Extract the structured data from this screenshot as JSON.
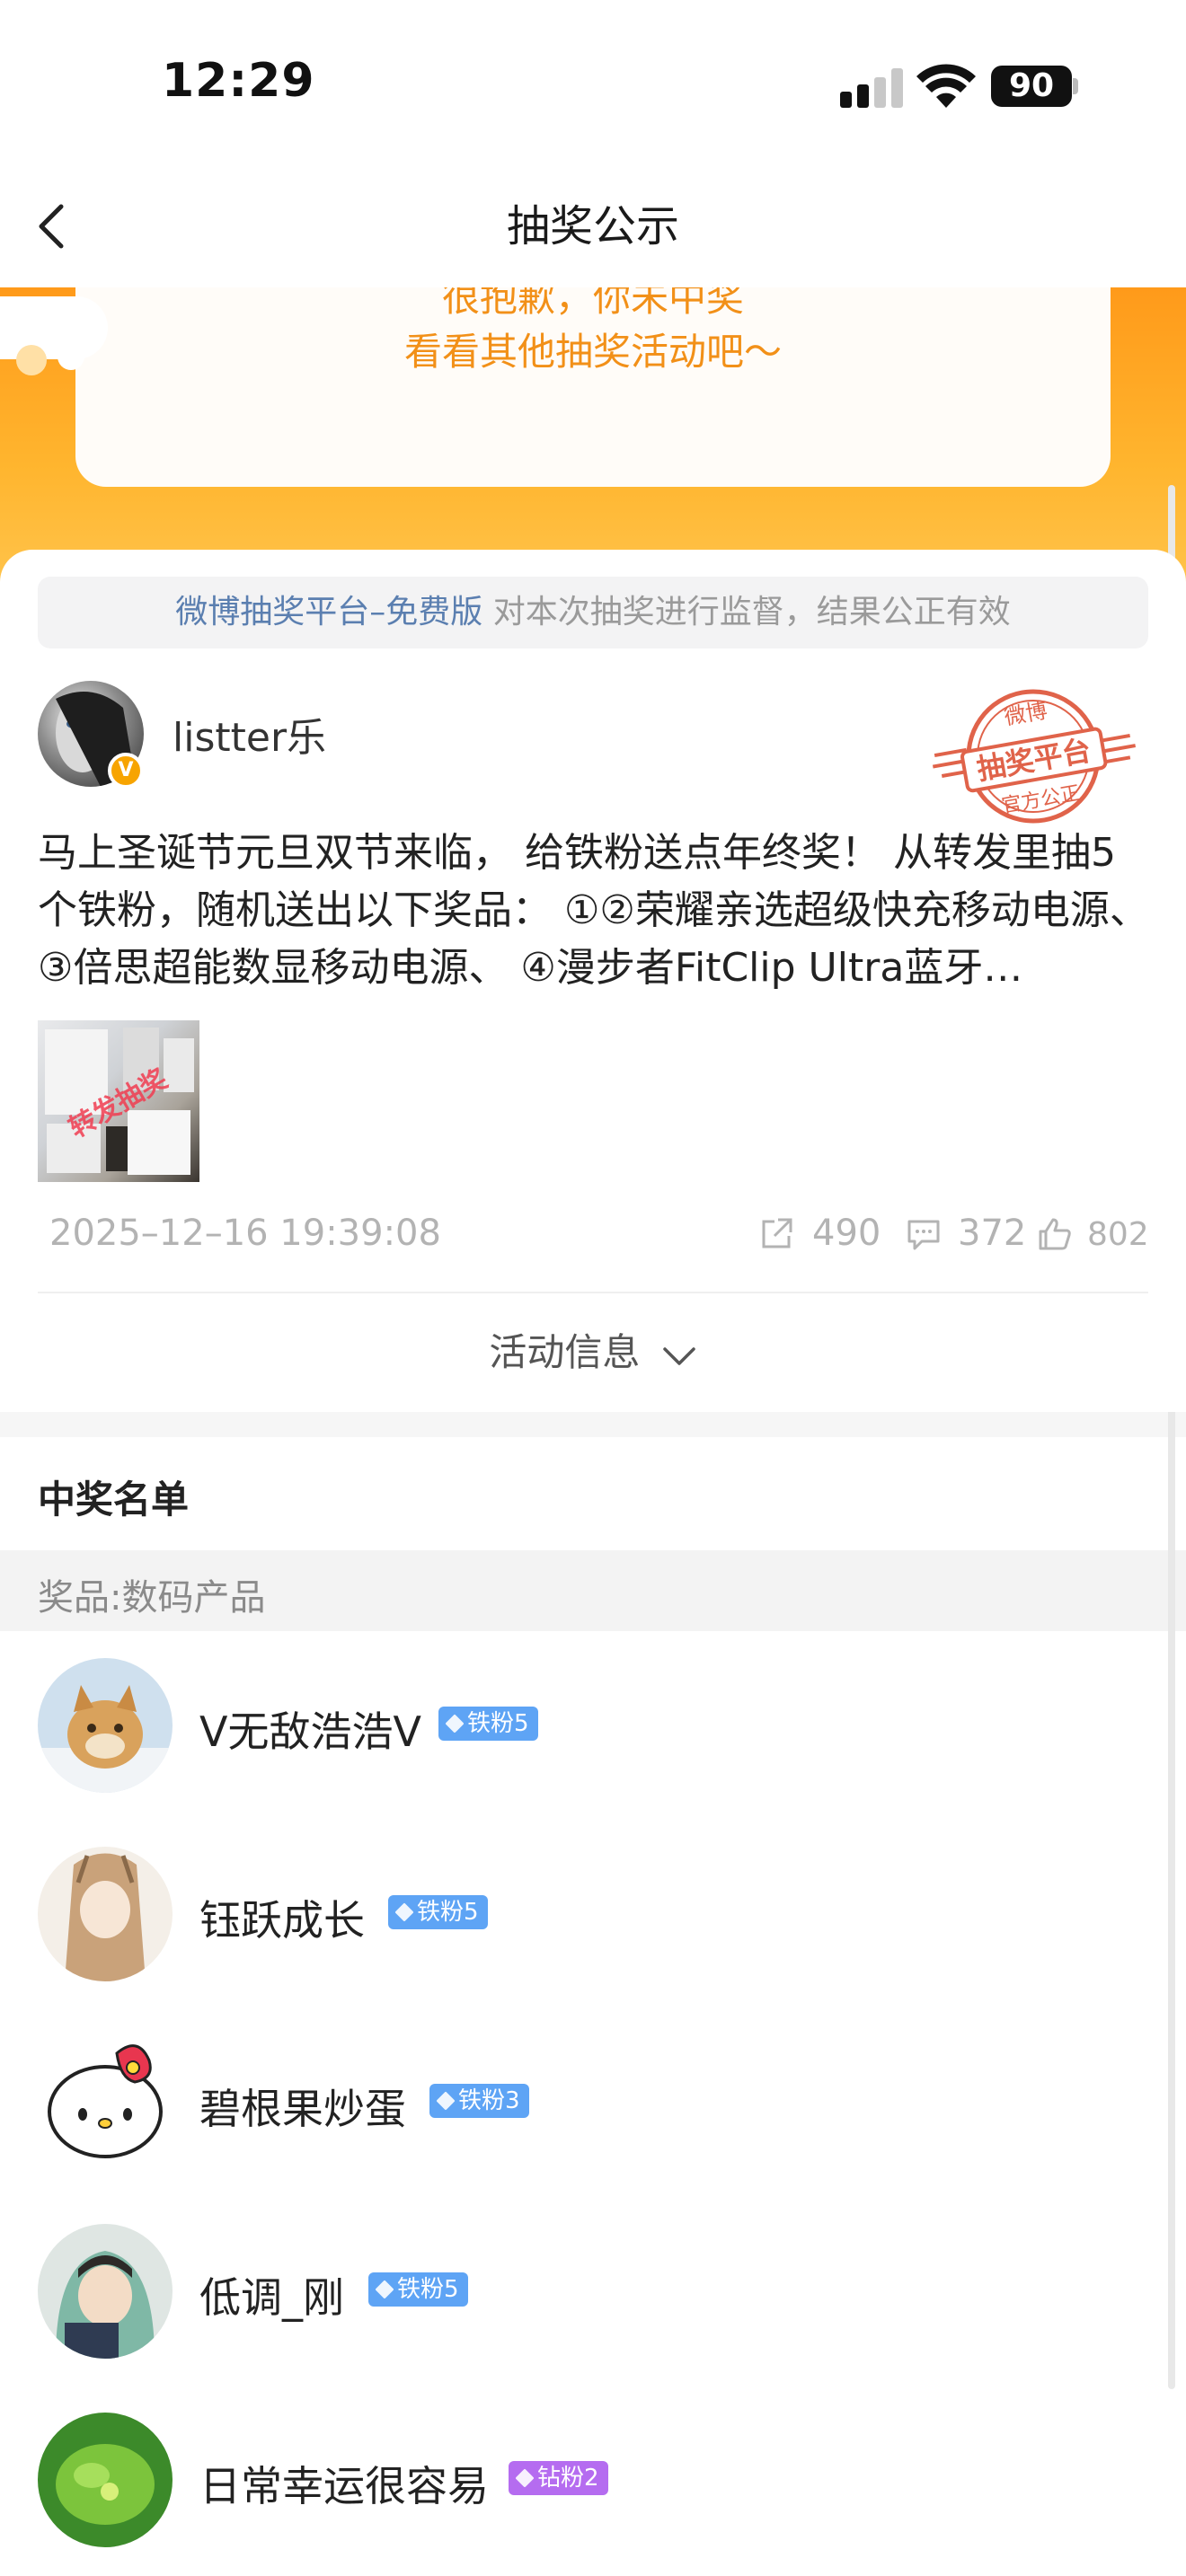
{
  "status_bar": {
    "time": "12:29",
    "battery": "90"
  },
  "nav": {
    "title": "抽奖公示"
  },
  "banner": {
    "sorry": "很抱歉，你未中奖",
    "see_more": "看看其他抽奖活动吧～"
  },
  "monitor": {
    "platform": "微博抽奖平台–免费版",
    "statement": " 对本次抽奖进行监督，结果公正有效"
  },
  "post": {
    "user_name": "listter乐",
    "stamp_top": "微博",
    "stamp_main": "抽奖平台",
    "stamp_bottom": "官方公正",
    "text": "马上圣诞节元旦双节来临， 给铁粉送点年终奖！ 从转发里抽5个铁粉，随机送出以下奖品： ①②荣耀亲选超级快充移动电源、 ③倍思超能数显移动电源、 ④漫步者FitClip Ultra蓝牙…",
    "image_watermark": "转发抽奖",
    "time": "2025–12–16 19:39:08",
    "reposts": "490",
    "comments": "372",
    "likes": "802",
    "activity_info": "活动信息"
  },
  "winners": {
    "title": "中奖名单",
    "prize": "奖品:数码产品",
    "list": [
      {
        "name": "V无敌浩浩V",
        "badge": "铁粉5",
        "badge_color": "#5ea4f5"
      },
      {
        "name": "钰跃成长",
        "badge": "铁粉5",
        "badge_color": "#5ea4f5"
      },
      {
        "name": "碧根果炒蛋",
        "badge": "铁粉3",
        "badge_color": "#5ea4f5"
      },
      {
        "name": "低调_刚",
        "badge": "铁粉5",
        "badge_color": "#5ea4f5"
      },
      {
        "name": "日常幸运很容易",
        "badge": "钻粉2",
        "badge_color": "#b56cf0"
      }
    ]
  },
  "colors": {
    "accent_orange": "#f29018",
    "link_blue": "#5b7fb0",
    "stamp_red": "#e0634a"
  }
}
